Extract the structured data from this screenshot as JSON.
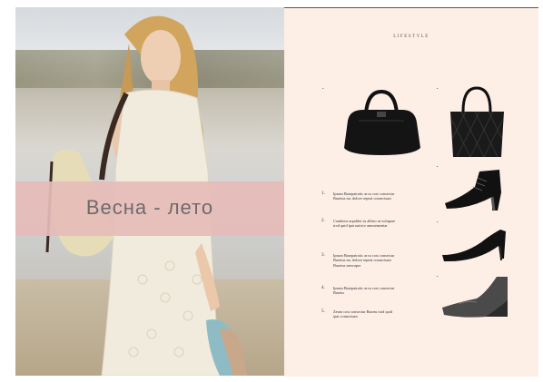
{
  "spread": {
    "banner_text": "Весна - лето",
    "header_label": "LIFESTYLE",
    "markers": [
      "1",
      "2",
      "3",
      "4",
      "5"
    ],
    "items": [
      {
        "num": "1.",
        "text": "Ipsum Basepatrotic arcu cost consectur Basetus nu. dolore repeat consectuan"
      },
      {
        "num": "2.",
        "text": "Condutor arpablot su albiso ut volupare trod quid tpat natrice amoutmentar"
      },
      {
        "num": "3.",
        "text": "Ipsum Basepatrotic arcu cost consectur Basetus nu. dolore repeat consectuan Basetus mercapre"
      },
      {
        "num": "4.",
        "text": "Ipsum Basepatrotic arcu cost consectur Basetu"
      },
      {
        "num": "5.",
        "text": "Zeum cost consectur Basetu trod quid tpat consectuan"
      }
    ]
  }
}
